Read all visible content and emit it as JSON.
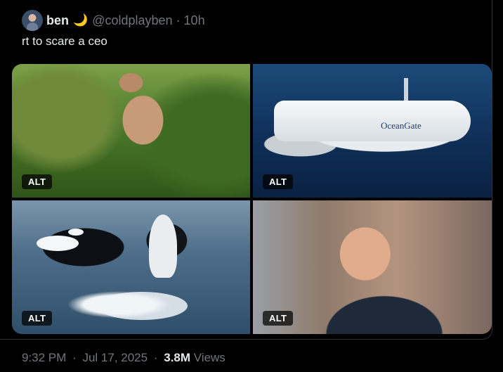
{
  "tweet": {
    "display_name": "ben",
    "name_emoji": "🌙",
    "handle": "@coldplayben",
    "separator": "·",
    "time_ago": "10h",
    "text": "rt to scare a ceo"
  },
  "media": {
    "alt_label": "ALT",
    "tiles": [
      {
        "subject": "hiker-photo",
        "alt": "ALT"
      },
      {
        "subject": "submarine-photo",
        "alt": "ALT",
        "logo_text": "OceanGate"
      },
      {
        "subject": "orca-photo",
        "alt": "ALT"
      },
      {
        "subject": "singer-photo",
        "alt": "ALT"
      }
    ]
  },
  "footer": {
    "time": "9:32 PM",
    "date": "Jul 17, 2025",
    "separator": "·",
    "views_count": "3.8M",
    "views_label": "Views"
  },
  "colors": {
    "background": "#000000",
    "text_primary": "#e7e9ea",
    "text_secondary": "#71767b",
    "border": "#2f3336"
  },
  "icons": {
    "avatar": "avatar",
    "moon": "moon-emoji-icon"
  }
}
